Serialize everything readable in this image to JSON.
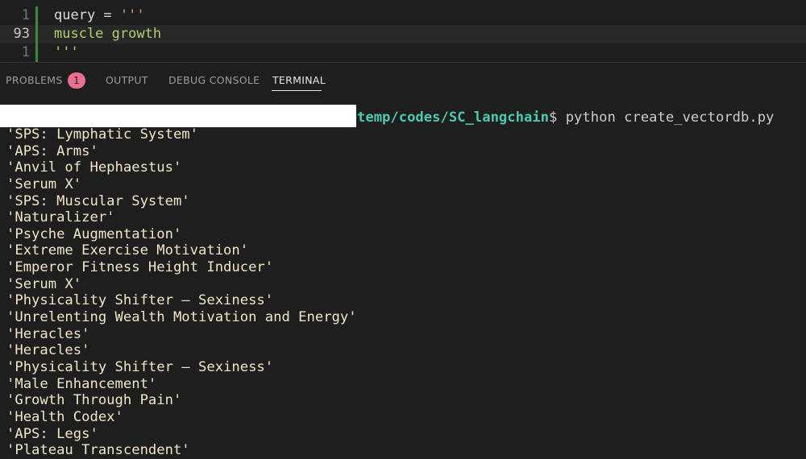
{
  "editor": {
    "lines": [
      {
        "number": "1",
        "var": "query",
        "op": " = ",
        "str": "'''"
      },
      {
        "number": "93",
        "text": "muscle growth"
      },
      {
        "number": "1",
        "text": "'''"
      }
    ],
    "top_fragment": "2"
  },
  "panel": {
    "tabs": [
      {
        "label": "PROBLEMS",
        "active": false
      },
      {
        "label": "OUTPUT",
        "active": false
      },
      {
        "label": "DEBUG CONSOLE",
        "active": false
      },
      {
        "label": "TERMINAL",
        "active": true
      }
    ],
    "problems_count": "1"
  },
  "terminal": {
    "prompt_path": "temp/codes/SC_langchain",
    "prompt_symbol": "$",
    "command": " python create_vectordb.py",
    "output": [
      "'SPS: Lymphatic System'",
      "'APS: Arms'",
      "'Anvil of Hephaestus'",
      "'Serum X'",
      "'SPS: Muscular System'",
      "'Naturalizer'",
      "'Psyche Augmentation'",
      "'Extreme Exercise Motivation'",
      "'Emperor Fitness Height Inducer'",
      "'Serum X'",
      "'Physicality Shifter – Sexiness'",
      "'Unrelenting Wealth Motivation and Energy'",
      "'Heracles'",
      "'Heracles'",
      "'Physicality Shifter – Sexiness'",
      "'Male Enhancement'",
      "'Growth Through Pain'",
      "'Health Codex'",
      "'APS: Legs'",
      "'Plateau Transcendent'"
    ]
  },
  "colors": {
    "background": "#1e1e1e",
    "badge": "#e86f8f",
    "prompt_path": "#4ec9b0",
    "string": "#b5cf6b",
    "output_text": "#f0e6c8"
  }
}
